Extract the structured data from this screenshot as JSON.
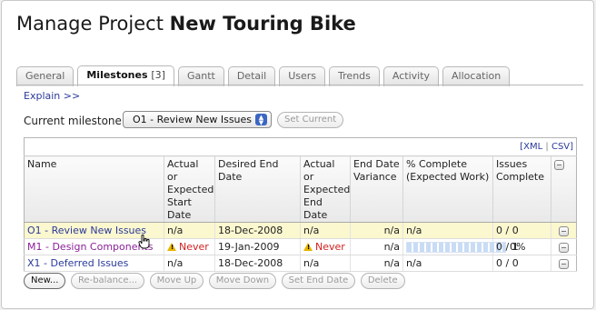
{
  "page": {
    "title_prefix": "Manage Project",
    "title_project": "New Touring Bike"
  },
  "tabs": [
    {
      "label": "General",
      "count": ""
    },
    {
      "label": "Milestones",
      "count": "[3]"
    },
    {
      "label": "Gantt",
      "count": ""
    },
    {
      "label": "Detail",
      "count": ""
    },
    {
      "label": "Users",
      "count": ""
    },
    {
      "label": "Trends",
      "count": ""
    },
    {
      "label": "Activity",
      "count": ""
    },
    {
      "label": "Allocation",
      "count": ""
    }
  ],
  "explain_link": "Explain >>",
  "current_milestone": {
    "label": "Current milestone",
    "selected": "O1 - Review New Issues",
    "set_current": "Set Current"
  },
  "table": {
    "export_links": {
      "xml": "XML",
      "csv": "CSV",
      "separator": "|",
      "open": "[",
      "close": "]"
    },
    "headers": {
      "name": "Name",
      "start": "Actual or Expected Start Date",
      "desired_end": "Desired End Date",
      "actual_end": "Actual or Expected End Date",
      "variance": "End Date Variance",
      "complete": "% Complete (Expected Work)",
      "issues": "Issues Complete"
    },
    "rows": [
      {
        "name": "O1 - Review New Issues",
        "start": "n/a",
        "desired_end": "18-Dec-2008",
        "actual_end": "n/a",
        "variance": "n/a",
        "complete": "n/a",
        "issues": "0 / 0"
      },
      {
        "name": "M1 - Design Components",
        "start": "Never",
        "desired_end": "19-Jan-2009",
        "actual_end": "Never",
        "variance": "n/a",
        "complete": "0%",
        "complete_fraction": 0.0,
        "issues": "0 / 1"
      },
      {
        "name": "X1 - Deferred Issues",
        "start": "n/a",
        "desired_end": "18-Dec-2008",
        "actual_end": "n/a",
        "variance": "n/a",
        "complete": "n/a",
        "issues": "0 / 0"
      }
    ]
  },
  "actions": {
    "new": "New...",
    "rebalance": "Re-balance...",
    "move_up": "Move Up",
    "move_down": "Move Down",
    "set_end_date": "Set End Date",
    "delete": "Delete"
  },
  "colors": {
    "link": "#2a3a9a",
    "visited_link": "#8a1f98",
    "warning": "#d32020",
    "selected_row": "#fbf7cf"
  }
}
